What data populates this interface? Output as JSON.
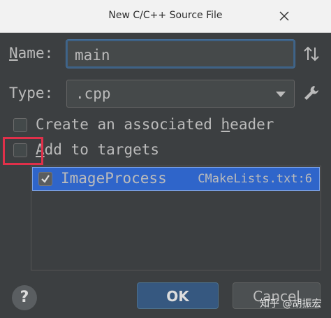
{
  "window": {
    "title": "New C/C++ Source File"
  },
  "form": {
    "name_label_prefix": "N",
    "name_label_rest": "ame:",
    "name_value": "main",
    "type_label_prefix": "Type",
    "type_label_underlined": "",
    "type_label_rest": ":",
    "type_value": ".cpp"
  },
  "options": {
    "create_header_prefix": "Create an associated ",
    "create_header_underlined": "h",
    "create_header_rest": "eader",
    "create_header_checked": false,
    "add_to_targets_underlined": "A",
    "add_to_targets_rest": "dd to targets",
    "add_to_targets_checked": false
  },
  "targets": [
    {
      "name": "ImageProcess",
      "file": "CMakeLists.txt:6",
      "checked": true
    }
  ],
  "buttons": {
    "help": "?",
    "ok": "OK",
    "cancel": "Cancel"
  },
  "watermark": "知乎 @胡振宏",
  "colors": {
    "background": "#3c3f41",
    "selection": "#2f65ca",
    "highlight": "#e0304a",
    "ok_button": "#365880"
  }
}
